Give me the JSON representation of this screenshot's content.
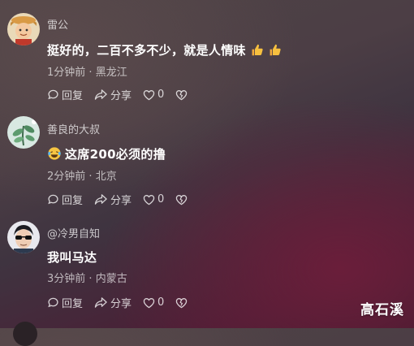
{
  "comments": [
    {
      "username": "雷公",
      "text": "挺好的，二百不多不少，就是人情味",
      "time": "1分钟前",
      "location": "黑龙江",
      "reply_label": "回复",
      "share_label": "分享",
      "like_count": "0",
      "avatar_icon": "cartoon-boy-avatar",
      "trailing_emoji": [
        "thumbs-up-icon",
        "thumbs-up-icon"
      ]
    },
    {
      "username": "善良的大叔",
      "text": "这席200必须的撸",
      "time": "2分钟前",
      "location": "北京",
      "reply_label": "回复",
      "share_label": "分享",
      "like_count": "0",
      "avatar_icon": "plant-photo-avatar",
      "leading_emoji": "laughing-tears-icon"
    },
    {
      "username": "@冷男自知",
      "text": "我叫马达",
      "time": "3分钟前",
      "location": "内蒙古",
      "reply_label": "回复",
      "share_label": "分享",
      "like_count": "0",
      "avatar_icon": "sunglasses-man-avatar"
    }
  ],
  "separator": " · ",
  "watermark": "高石溪",
  "colors": {
    "text_secondary": "#c7bfc3",
    "accent_bg": "#6a1e3a"
  }
}
